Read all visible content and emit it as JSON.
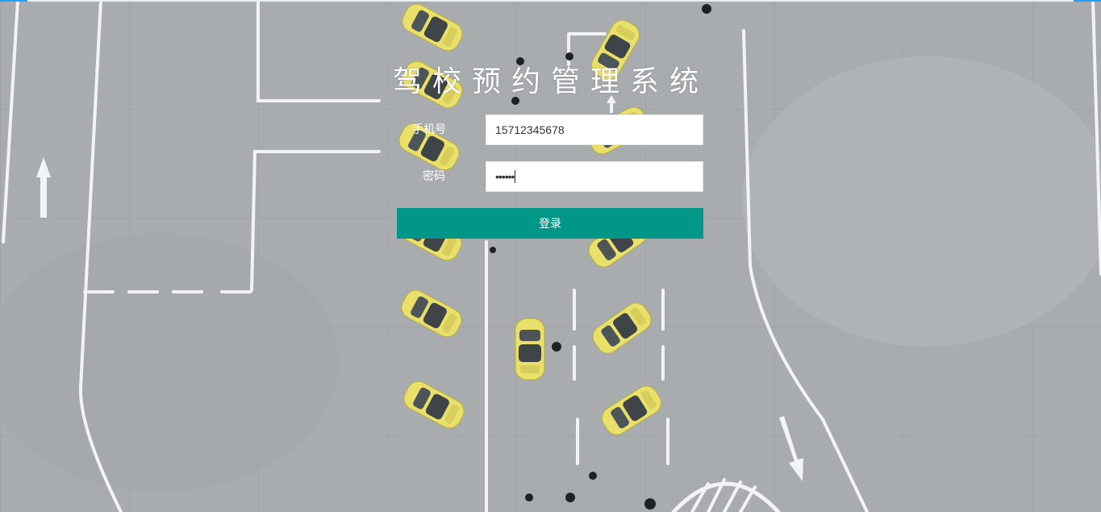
{
  "app": {
    "title": "驾校预约管理系统"
  },
  "form": {
    "phone_label": "手机号",
    "phone_value": "15712345678",
    "password_label": "密码",
    "password_masked": "••••••",
    "submit_label": "登录"
  },
  "colors": {
    "accent": "#009688",
    "topbar": "#1e9fff",
    "car": "#e8e06a",
    "ground": "#a9adb0"
  }
}
